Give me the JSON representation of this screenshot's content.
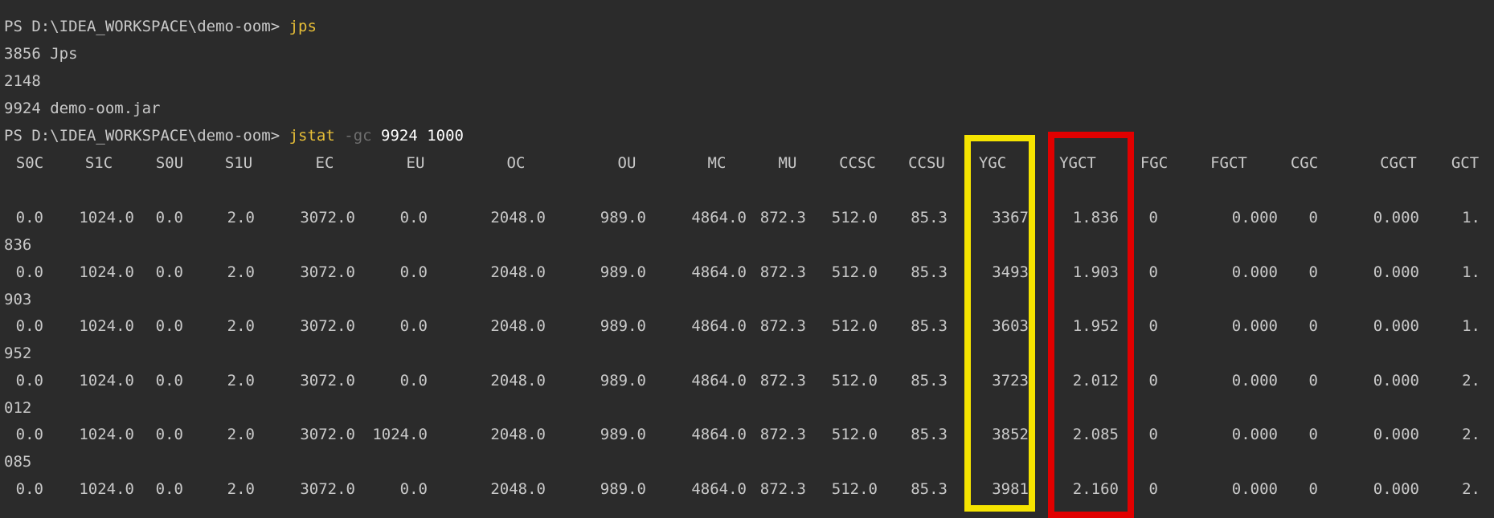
{
  "terminal": {
    "colors": {
      "background": "#2b2b2b",
      "text": "#c9c9c9",
      "command": "#e8bf37",
      "flag": "#6f6f6f",
      "highlight_ygc": "#f5e400",
      "highlight_ygct": "#e10000"
    },
    "lines": [
      {
        "prompt": "PS D:\\IDEA_WORKSPACE\\demo-oom> ",
        "cmd": "jps",
        "flag": "",
        "args": ""
      },
      {
        "output": "3856 Jps"
      },
      {
        "output": "2148"
      },
      {
        "output": "9924 demo-oom.jar"
      },
      {
        "prompt": "PS D:\\IDEA_WORKSPACE\\demo-oom> ",
        "cmd": "jstat",
        "flag": " -gc",
        "args": " 9924 1000"
      }
    ],
    "headers": [
      "S0C",
      "S1C",
      "S0U",
      "S1U",
      "EC",
      "EU",
      "OC",
      "OU",
      "MC",
      "MU",
      "CCSC",
      "CCSU",
      "YGC",
      "YGCT",
      "FGC",
      "FGCT",
      "CGC",
      "CGCT",
      "GCT"
    ],
    "rows": [
      {
        "values": [
          "0.0",
          "1024.0",
          "0.0",
          "2.0",
          "3072.0",
          "0.0",
          "2048.0",
          "989.0",
          "4864.0",
          "872.3",
          "512.0",
          "85.3",
          "3367",
          "1.836",
          "0",
          "0.000",
          "0",
          "0.000",
          "1."
        ],
        "wrap": "836"
      },
      {
        "values": [
          "0.0",
          "1024.0",
          "0.0",
          "2.0",
          "3072.0",
          "0.0",
          "2048.0",
          "989.0",
          "4864.0",
          "872.3",
          "512.0",
          "85.3",
          "3493",
          "1.903",
          "0",
          "0.000",
          "0",
          "0.000",
          "1."
        ],
        "wrap": "903"
      },
      {
        "values": [
          "0.0",
          "1024.0",
          "0.0",
          "2.0",
          "3072.0",
          "0.0",
          "2048.0",
          "989.0",
          "4864.0",
          "872.3",
          "512.0",
          "85.3",
          "3603",
          "1.952",
          "0",
          "0.000",
          "0",
          "0.000",
          "1."
        ],
        "wrap": "952"
      },
      {
        "values": [
          "0.0",
          "1024.0",
          "0.0",
          "2.0",
          "3072.0",
          "0.0",
          "2048.0",
          "989.0",
          "4864.0",
          "872.3",
          "512.0",
          "85.3",
          "3723",
          "2.012",
          "0",
          "0.000",
          "0",
          "0.000",
          "2."
        ],
        "wrap": "012"
      },
      {
        "values": [
          "0.0",
          "1024.0",
          "0.0",
          "2.0",
          "3072.0",
          "1024.0",
          "2048.0",
          "989.0",
          "4864.0",
          "872.3",
          "512.0",
          "85.3",
          "3852",
          "2.085",
          "0",
          "0.000",
          "0",
          "0.000",
          "2."
        ],
        "wrap": "085"
      },
      {
        "values": [
          "0.0",
          "1024.0",
          "0.0",
          "2.0",
          "3072.0",
          "0.0",
          "2048.0",
          "989.0",
          "4864.0",
          "872.3",
          "512.0",
          "85.3",
          "3981",
          "2.160",
          "0",
          "0.000",
          "0",
          "0.000",
          "2."
        ],
        "wrap": ""
      }
    ]
  }
}
